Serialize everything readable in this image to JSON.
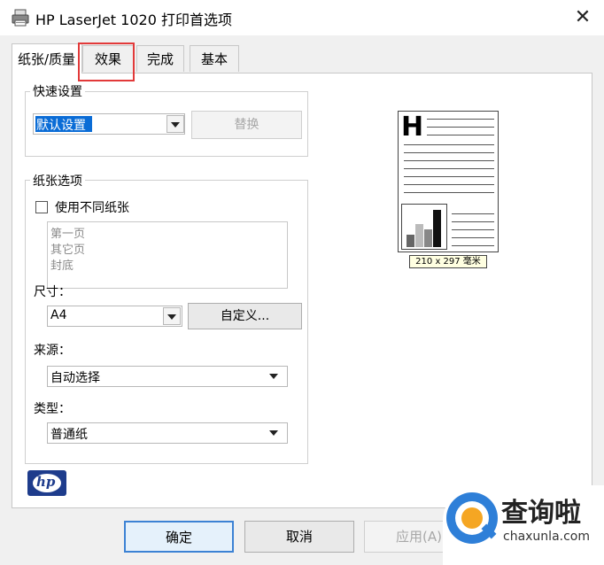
{
  "window": {
    "title": "HP LaserJet 1020 打印首选项",
    "icon": "printer-icon",
    "close_glyph": "✕"
  },
  "tabs": [
    {
      "label": "纸张/质量",
      "selected": true
    },
    {
      "label": "效果",
      "highlighted": true
    },
    {
      "label": "完成"
    },
    {
      "label": "基本"
    }
  ],
  "quick_settings": {
    "legend": "快速设置",
    "value": "默认设置",
    "replace_label": "替换"
  },
  "paper_options": {
    "legend": "纸张选项",
    "use_different_paper_label": "使用不同纸张",
    "use_different_paper_checked": false,
    "pages": [
      "第一页",
      "其它页",
      "封底"
    ],
    "size_label": "尺寸：",
    "size_value": "A4",
    "custom_label": "自定义...",
    "source_label": "来源：",
    "source_value": "自动选择",
    "type_label": "类型：",
    "type_value": "普通纸"
  },
  "preview": {
    "size_text": "210 x 297 毫米",
    "letter": "H"
  },
  "footer": {
    "ok_label": "确定",
    "cancel_label": "取消",
    "apply_label": "应用(A)"
  },
  "watermark": {
    "title": "查询啦",
    "url": "chaxunla.com"
  },
  "logo": "hp",
  "colors": {
    "highlight": "#e23a3a",
    "selection": "#0a6cd6",
    "default_button_border": "#3c82d4"
  }
}
